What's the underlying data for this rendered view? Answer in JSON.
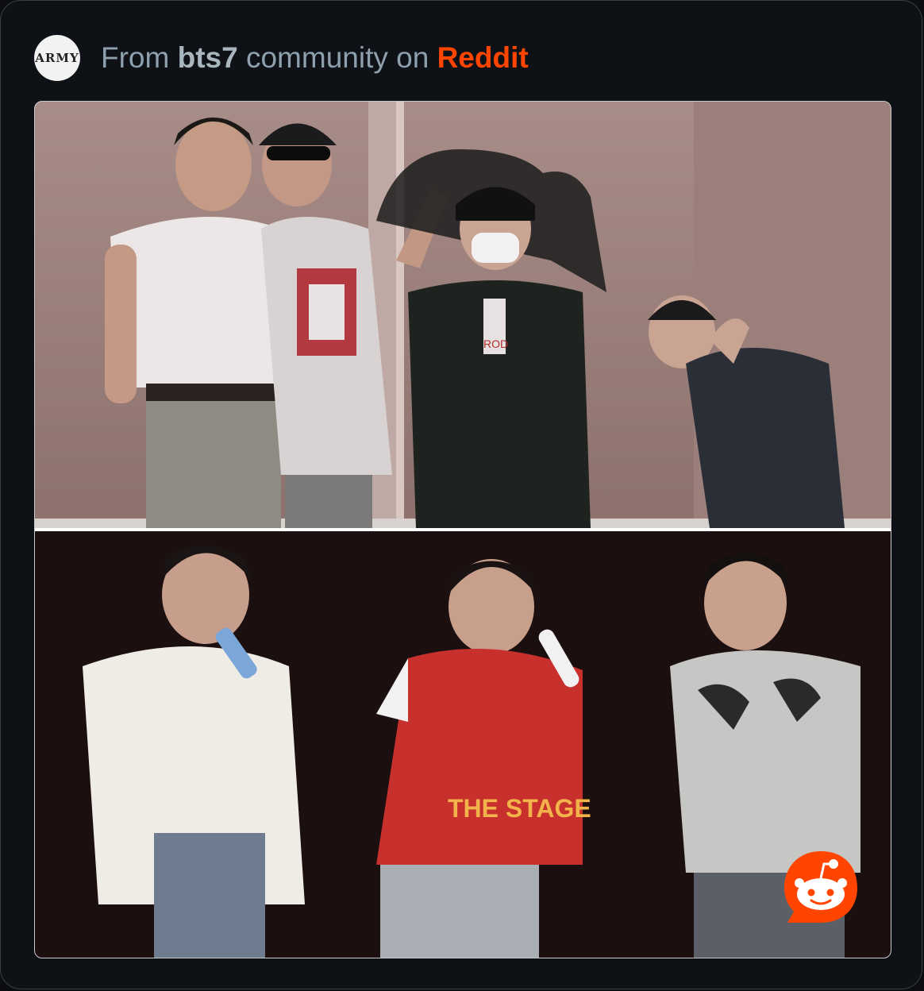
{
  "post": {
    "source_prefix": "From",
    "community": "bts7",
    "source_middle": "community on",
    "platform": "Reddit",
    "avatar_text": "ARMY"
  },
  "media": {
    "photos": [
      {
        "label": "top-photo"
      },
      {
        "label": "bottom-photo"
      }
    ],
    "top_shirt_text": "ROD",
    "bottom_shirt_text": "THE STAGE"
  },
  "colors": {
    "background": "#0e1116",
    "reddit_orange": "#ff4500",
    "muted_text": "#8ea0ad"
  },
  "icons": {
    "reddit_badge": "reddit-snoo-icon"
  }
}
